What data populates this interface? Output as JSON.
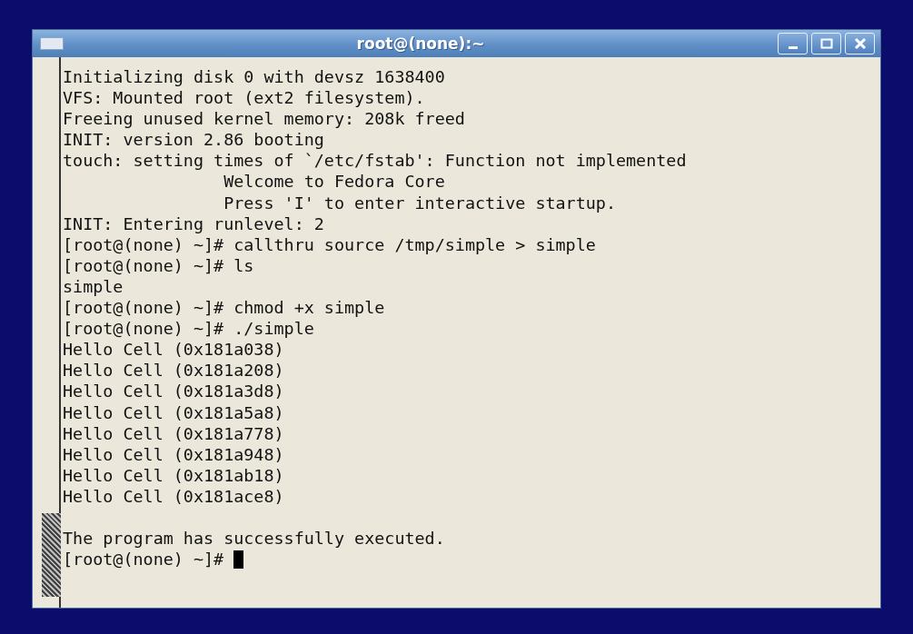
{
  "window": {
    "title": "root@(none):~"
  },
  "terminal": {
    "cursor_visible": true,
    "lines": [
      {
        "kind": "text",
        "text": "Initializing disk 0 with devsz 1638400"
      },
      {
        "kind": "text",
        "text": "VFS: Mounted root (ext2 filesystem)."
      },
      {
        "kind": "text",
        "text": "Freeing unused kernel memory: 208k freed"
      },
      {
        "kind": "text",
        "text": "INIT: version 2.86 booting"
      },
      {
        "kind": "text",
        "text": "touch: setting times of `/etc/fstab': Function not implemented"
      },
      {
        "kind": "text",
        "text": "                Welcome to Fedora Core"
      },
      {
        "kind": "text",
        "text": "                Press 'I' to enter interactive startup."
      },
      {
        "kind": "text",
        "text": "INIT: Entering runlevel: 2"
      },
      {
        "kind": "text",
        "text": "[root@(none) ~]# callthru source /tmp/simple > simple"
      },
      {
        "kind": "text",
        "text": "[root@(none) ~]# ls"
      },
      {
        "kind": "text",
        "text": "simple"
      },
      {
        "kind": "text",
        "text": "[root@(none) ~]# chmod +x simple"
      },
      {
        "kind": "text",
        "text": "[root@(none) ~]# ./simple"
      },
      {
        "kind": "text",
        "text": "Hello Cell (0x181a038)"
      },
      {
        "kind": "text",
        "text": "Hello Cell (0x181a208)"
      },
      {
        "kind": "text",
        "text": "Hello Cell (0x181a3d8)"
      },
      {
        "kind": "text",
        "text": "Hello Cell (0x181a5a8)"
      },
      {
        "kind": "text",
        "text": "Hello Cell (0x181a778)"
      },
      {
        "kind": "text",
        "text": "Hello Cell (0x181a948)"
      },
      {
        "kind": "text",
        "text": "Hello Cell (0x181ab18)"
      },
      {
        "kind": "text",
        "text": "Hello Cell (0x181ace8)"
      },
      {
        "kind": "blank"
      },
      {
        "kind": "text",
        "text": "The program has successfully executed."
      },
      {
        "kind": "prompt",
        "text": "[root@(none) ~]#"
      }
    ]
  }
}
